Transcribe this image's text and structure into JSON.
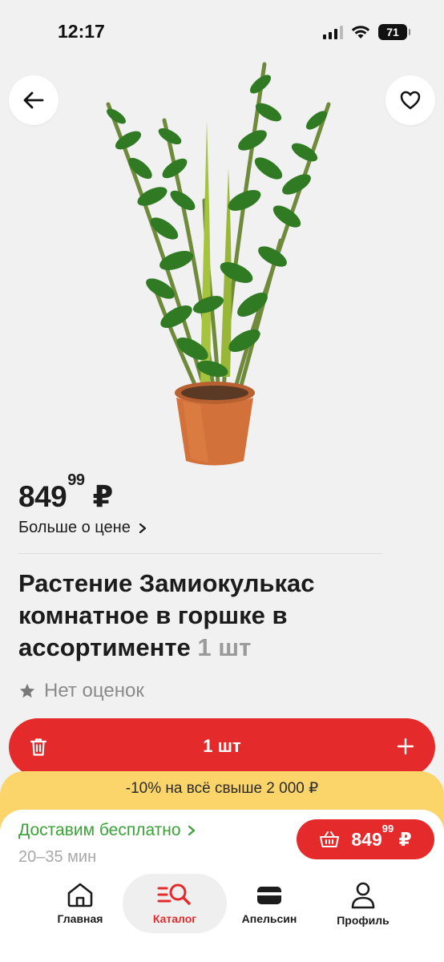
{
  "status_bar": {
    "time": "12:17",
    "battery": "71"
  },
  "price": {
    "main": "849",
    "cents": "99",
    "currency": "₽",
    "more_label": "Больше о цене"
  },
  "product": {
    "title": "Растение Замиокулькас комнатное в горшке в ассортименте",
    "quantity_note": "1 шт",
    "rating_text": "Нет оценок"
  },
  "cart_control": {
    "quantity_label": "1 шт"
  },
  "promo": {
    "text": "-10% на всё свыше 2 000 ₽"
  },
  "delivery": {
    "title": "Доставим бесплатно",
    "time": "20–35 мин"
  },
  "cart_button": {
    "price_main": "849",
    "price_cents": "99",
    "currency": "₽"
  },
  "bottom_nav": {
    "items": [
      {
        "label": "Главная",
        "icon": "home-icon"
      },
      {
        "label": "Каталог",
        "icon": "catalog-search-icon"
      },
      {
        "label": "Апельсин",
        "icon": "card-icon"
      },
      {
        "label": "Профиль",
        "icon": "profile-icon"
      }
    ]
  },
  "colors": {
    "accent": "#e42a2a",
    "promo": "#fbd56a",
    "delivery_green": "#3aa236"
  }
}
